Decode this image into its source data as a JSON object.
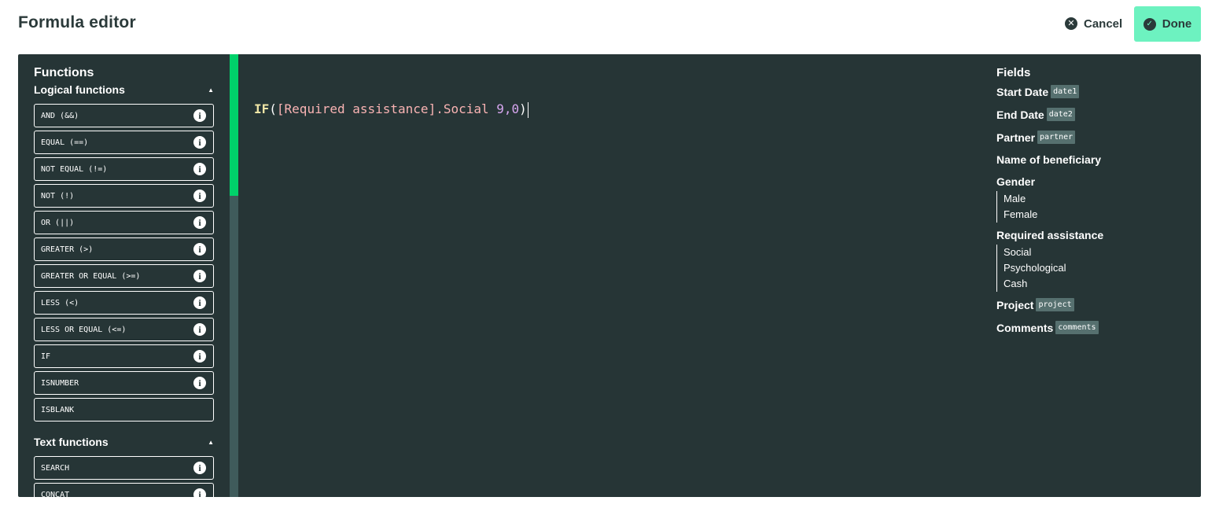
{
  "header": {
    "title": "Formula editor",
    "cancel_label": "Cancel",
    "done_label": "Done"
  },
  "functions": {
    "title": "Functions",
    "groups": [
      {
        "title": "Logical functions",
        "items": [
          {
            "label": "AND (&&)",
            "info": true
          },
          {
            "label": "EQUAL (==)",
            "info": true
          },
          {
            "label": "NOT EQUAL (!=)",
            "info": true
          },
          {
            "label": "NOT (!)",
            "info": true
          },
          {
            "label": "OR (||)",
            "info": true
          },
          {
            "label": "GREATER (>)",
            "info": true
          },
          {
            "label": "GREATER OR EQUAL (>=)",
            "info": true
          },
          {
            "label": "LESS (<)",
            "info": true
          },
          {
            "label": "LESS OR EQUAL (<=)",
            "info": true
          },
          {
            "label": "IF",
            "info": true
          },
          {
            "label": "ISNUMBER",
            "info": true
          },
          {
            "label": "ISBLANK",
            "info": false
          }
        ]
      },
      {
        "title": "Text functions",
        "items": [
          {
            "label": "SEARCH",
            "info": true
          },
          {
            "label": "CONCAT",
            "info": true
          }
        ]
      }
    ]
  },
  "formula": {
    "fn": "IF",
    "open": "(",
    "field": "[Required assistance].Social",
    "args": " 9,0",
    "close": ")"
  },
  "fields": {
    "title": "Fields",
    "items": [
      {
        "label": "Start Date",
        "tag": "date1"
      },
      {
        "label": "End Date",
        "tag": "date2"
      },
      {
        "label": "Partner",
        "tag": "partner"
      },
      {
        "label": "Name of beneficiary",
        "tag": ""
      },
      {
        "label": "Gender",
        "tag": "",
        "options": [
          "Male",
          "Female"
        ]
      },
      {
        "label": "Required assistance",
        "tag": "",
        "options": [
          "Social",
          "Psychological",
          "Cash"
        ]
      },
      {
        "label": "Project",
        "tag": "project"
      },
      {
        "label": "Comments",
        "tag": "comments"
      }
    ]
  },
  "colors": {
    "panel_bg": "#263536",
    "accent_green": "#00d26a",
    "done_bg": "#6df2c0"
  }
}
